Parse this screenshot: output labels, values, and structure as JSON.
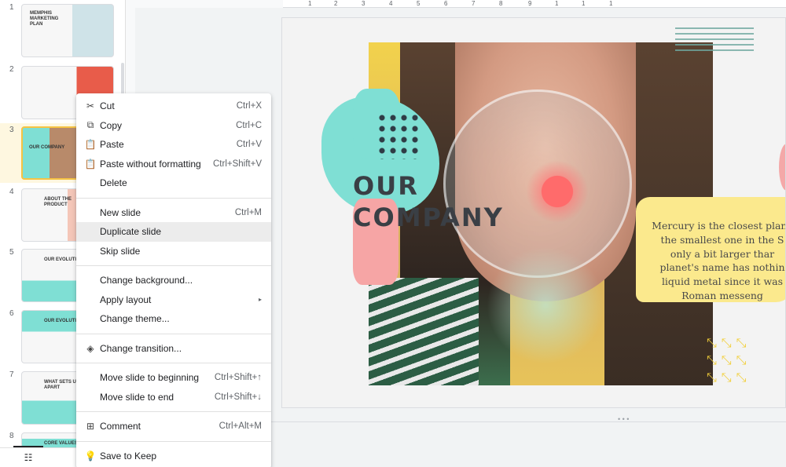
{
  "filmstrip": {
    "slides": [
      {
        "number": "1",
        "title": "MEMPHIS MARKETING PLAN"
      },
      {
        "number": "2",
        "title": ""
      },
      {
        "number": "3",
        "title": "OUR COMPANY"
      },
      {
        "number": "4",
        "title": "ABOUT THE PRODUCT"
      },
      {
        "number": "5",
        "title": "OUR EVOLUTION"
      },
      {
        "number": "6",
        "title": "OUR EVOLUTION"
      },
      {
        "number": "7",
        "title": "WHAT SETS US APART"
      },
      {
        "number": "8",
        "title": "CORE VALUES"
      }
    ],
    "selected_slide": "3"
  },
  "ruler": {
    "ticks": [
      "1",
      "2",
      "3",
      "4",
      "5",
      "6",
      "7",
      "8",
      "9",
      "1",
      "1",
      "1"
    ]
  },
  "slide": {
    "title_line1": "OUR",
    "title_line2": "COMPANY",
    "body_lines": [
      "Mercury is the closest plane",
      "the smallest one in the S",
      "only a bit larger thar",
      "planet's name has nothin",
      "liquid metal since it was",
      "Roman messeng"
    ],
    "colors": {
      "teal": "#7fdfd4",
      "yellow": "#fbe98d",
      "pink": "#f6a5a5",
      "title": "#3a3f45"
    }
  },
  "context_menu": {
    "groups": [
      [
        {
          "label": "Cut",
          "shortcut": "Ctrl+X",
          "icon": "scissors-icon",
          "glyph": "✂"
        },
        {
          "label": "Copy",
          "shortcut": "Ctrl+C",
          "icon": "copy-icon",
          "glyph": "⧉"
        },
        {
          "label": "Paste",
          "shortcut": "Ctrl+V",
          "icon": "paste-icon",
          "glyph": "📋"
        },
        {
          "label": "Paste without formatting",
          "shortcut": "Ctrl+Shift+V",
          "icon": "paste-plain-icon",
          "glyph": "📋"
        },
        {
          "label": "Delete",
          "shortcut": "",
          "icon": "",
          "glyph": ""
        }
      ],
      [
        {
          "label": "New slide",
          "shortcut": "Ctrl+M",
          "icon": "",
          "glyph": ""
        },
        {
          "label": "Duplicate slide",
          "shortcut": "",
          "icon": "",
          "glyph": "",
          "state": "highlighted"
        },
        {
          "label": "Skip slide",
          "shortcut": "",
          "icon": "",
          "glyph": ""
        }
      ],
      [
        {
          "label": "Change background...",
          "shortcut": "",
          "icon": "",
          "glyph": ""
        },
        {
          "label": "Apply layout",
          "shortcut": "",
          "icon": "",
          "glyph": "",
          "submenu": "▸"
        },
        {
          "label": "Change theme...",
          "shortcut": "",
          "icon": "",
          "glyph": ""
        }
      ],
      [
        {
          "label": "Change transition...",
          "shortcut": "",
          "icon": "transition-icon",
          "glyph": "◈"
        }
      ],
      [
        {
          "label": "Move slide to beginning",
          "shortcut": "Ctrl+Shift+↑",
          "icon": "",
          "glyph": ""
        },
        {
          "label": "Move slide to end",
          "shortcut": "Ctrl+Shift+↓",
          "icon": "",
          "glyph": ""
        }
      ],
      [
        {
          "label": "Comment",
          "shortcut": "Ctrl+Alt+M",
          "icon": "comment-add-icon",
          "glyph": "⊞"
        }
      ],
      [
        {
          "label": "Save to Keep",
          "shortcut": "",
          "icon": "keep-bulb-icon",
          "glyph": "💡"
        }
      ]
    ]
  },
  "bottom_bar": {
    "view_icon": "grid-view-icon",
    "glyph": "☷"
  }
}
